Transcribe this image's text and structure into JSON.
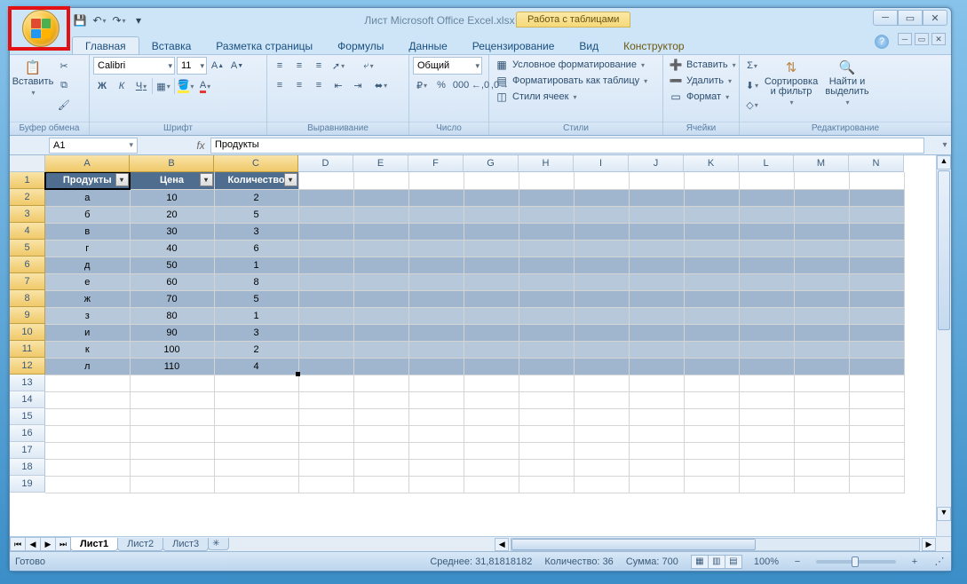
{
  "title": {
    "doc": "Лист Microsoft Office Excel.xlsx",
    "app": "Microsoft Excel",
    "context_group": "Работа с таблицами"
  },
  "tabs": [
    "Главная",
    "Вставка",
    "Разметка страницы",
    "Формулы",
    "Данные",
    "Рецензирование",
    "Вид",
    "Конструктор"
  ],
  "active_tab": 0,
  "ribbon": {
    "clipboard": {
      "label": "Буфер обмена",
      "paste": "Вставить"
    },
    "font": {
      "label": "Шрифт",
      "family": "Calibri",
      "size": "11",
      "bold": "Ж",
      "italic": "К",
      "underline": "Ч"
    },
    "alignment": {
      "label": "Выравнивание"
    },
    "number": {
      "label": "Число",
      "format": "Общий"
    },
    "styles": {
      "label": "Стили",
      "cond": "Условное форматирование",
      "as_table": "Форматировать как таблицу",
      "cell": "Стили ячеек"
    },
    "cells": {
      "label": "Ячейки",
      "insert": "Вставить",
      "delete": "Удалить",
      "format": "Формат"
    },
    "editing": {
      "label": "Редактирование",
      "sort": "Сортировка и фильтр",
      "find": "Найти и выделить"
    }
  },
  "namebox": "A1",
  "formula": "Продукты",
  "columns": [
    "A",
    "B",
    "C",
    "D",
    "E",
    "F",
    "G",
    "H",
    "I",
    "J",
    "K",
    "L",
    "M",
    "N"
  ],
  "table": {
    "headers": [
      "Продукты",
      "Цена",
      "Количество"
    ],
    "rows": [
      [
        "а",
        "10",
        "2"
      ],
      [
        "б",
        "20",
        "5"
      ],
      [
        "в",
        "30",
        "3"
      ],
      [
        "г",
        "40",
        "6"
      ],
      [
        "д",
        "50",
        "1"
      ],
      [
        "е",
        "60",
        "8"
      ],
      [
        "ж",
        "70",
        "5"
      ],
      [
        "з",
        "80",
        "1"
      ],
      [
        "и",
        "90",
        "3"
      ],
      [
        "к",
        "100",
        "2"
      ],
      [
        "л",
        "110",
        "4"
      ]
    ]
  },
  "sheets": [
    "Лист1",
    "Лист2",
    "Лист3"
  ],
  "status": {
    "ready": "Готово",
    "avg_label": "Среднее:",
    "avg": "31,81818182",
    "count_label": "Количество:",
    "count": "36",
    "sum_label": "Сумма:",
    "sum": "700",
    "zoom": "100%"
  }
}
